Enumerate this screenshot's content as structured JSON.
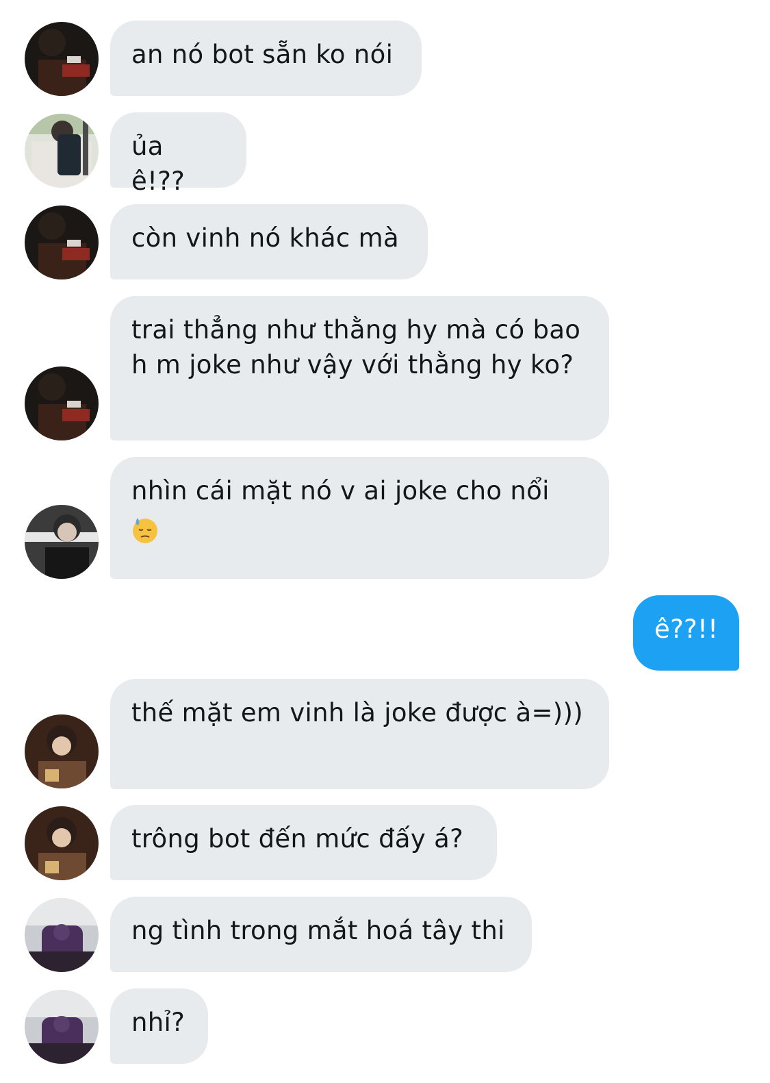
{
  "messages": [
    {
      "text": "an nó bot sẵn ko nói"
    },
    {
      "text": "ủa ê!??"
    },
    {
      "text": "còn vinh nó khác mà"
    },
    {
      "text": "trai thẳng như thằng hy mà có bao h m joke như vậy với thằng hy ko?"
    },
    {
      "text": "nhìn cái mặt nó v ai joke cho nổi",
      "emoji": "downcast-face-with-sweat-emoji"
    },
    {
      "text": "ê??!!",
      "sent": true
    },
    {
      "text": "thế mặt em vinh là joke được à=)))"
    },
    {
      "text": "trông bot đến mức đấy á?"
    },
    {
      "text": "ng tình trong mắt hoá tây thi"
    },
    {
      "text": "nhỉ?"
    }
  ],
  "colors": {
    "incoming_bubble": "#e7ebee",
    "outgoing_bubble": "#1da1f2",
    "text": "#14171a"
  }
}
